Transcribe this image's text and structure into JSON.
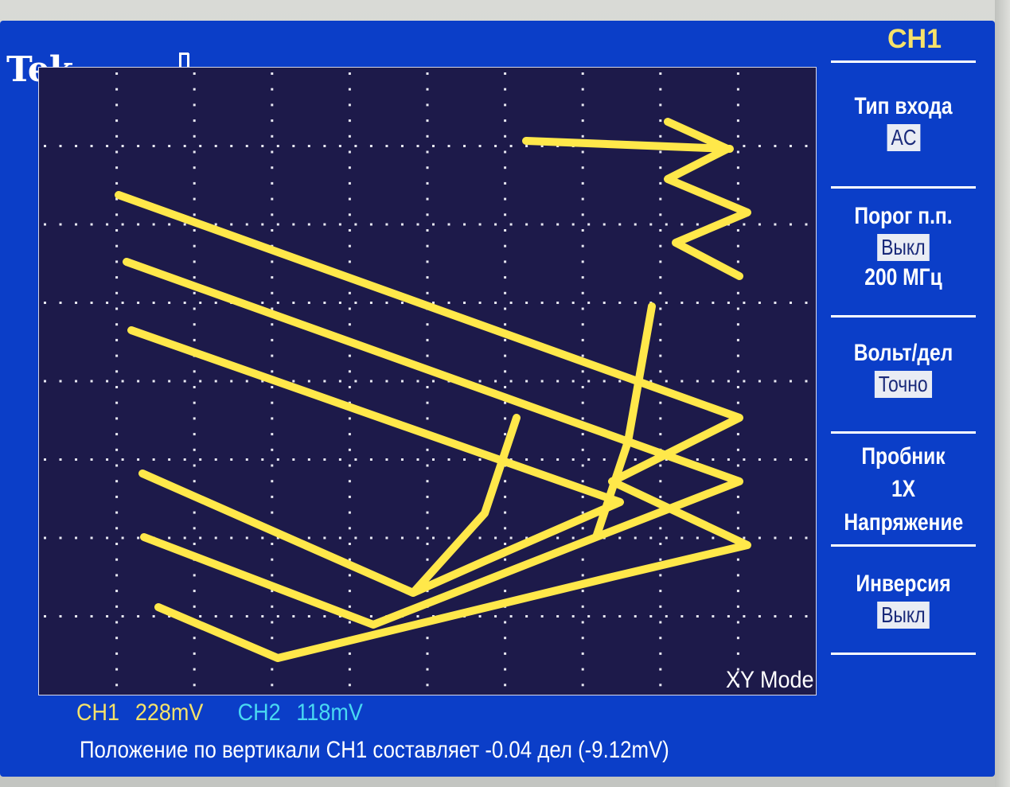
{
  "brand": "Tek",
  "icons": {
    "trigger": "trigger-pulse-icon"
  },
  "colors": {
    "screen_bg": "#0b3ec8",
    "graticule_bg": "#1d1a4a",
    "ch1_color": "#f6e26a",
    "ch2_color": "#49d9f2",
    "trace_color": "#ffe84a"
  },
  "display": {
    "mode": "XY Mode",
    "graticule": {
      "h_divisions": 10,
      "v_divisions": 8
    }
  },
  "menu": {
    "title": "CH1",
    "items": [
      {
        "label": "Тип входа",
        "value": "AC"
      },
      {
        "label": "Порог п.п.",
        "value": "Выкл",
        "extra": "200 МГц"
      },
      {
        "label": "Вольт/дел",
        "value": "Точно"
      },
      {
        "label": "Пробник",
        "lines": [
          "1X",
          "Напряжение"
        ]
      },
      {
        "label": "Инверсия",
        "value": "Выкл"
      }
    ]
  },
  "status": {
    "ch1_label": "CH1",
    "ch1_scale": "228mV",
    "ch2_label": "CH2",
    "ch2_scale": "118mV",
    "offset_suffix": "-9.12mV)"
  },
  "message": "Положение по вертикали CH1 составляет -0.04 дел (-9.12mV)"
}
